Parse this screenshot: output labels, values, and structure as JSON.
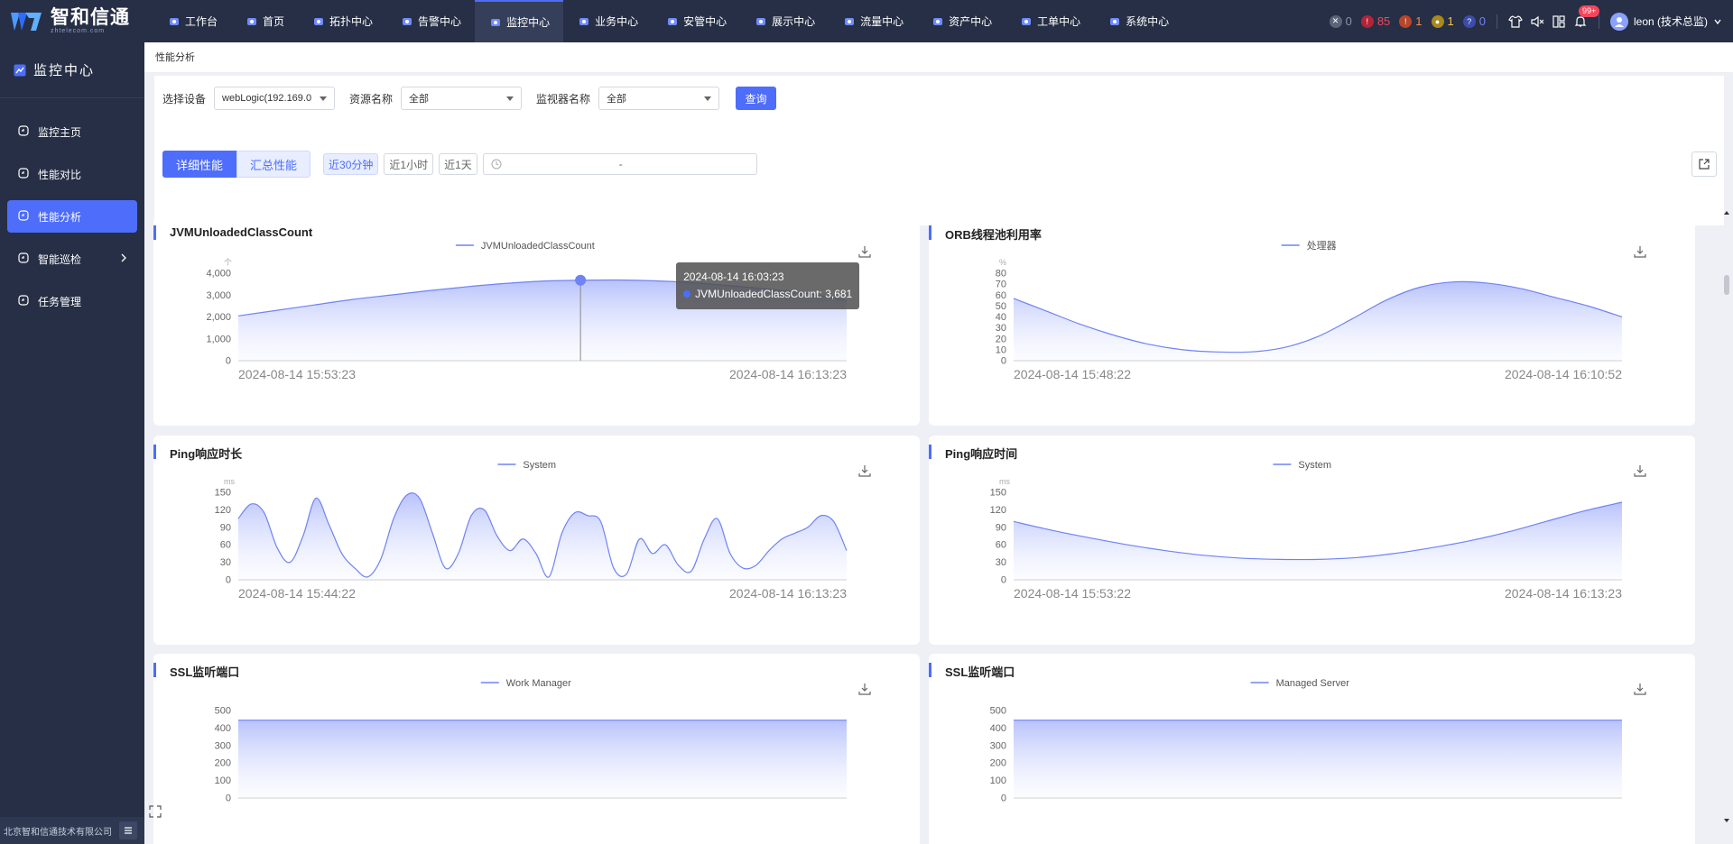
{
  "brand": {
    "name": "智和信通",
    "sub": "zhtelecom.com"
  },
  "nav": [
    {
      "label": "工作台",
      "icon": "workbench-icon",
      "active": false
    },
    {
      "label": "首页",
      "icon": "home-icon",
      "active": false
    },
    {
      "label": "拓扑中心",
      "icon": "topology-icon",
      "active": false
    },
    {
      "label": "告警中心",
      "icon": "alarm-icon",
      "active": false
    },
    {
      "label": "监控中心",
      "icon": "monitor-icon",
      "active": true
    },
    {
      "label": "业务中心",
      "icon": "business-icon",
      "active": false
    },
    {
      "label": "安管中心",
      "icon": "security-icon",
      "active": false
    },
    {
      "label": "展示中心",
      "icon": "display-icon",
      "active": false
    },
    {
      "label": "流量中心",
      "icon": "traffic-icon",
      "active": false
    },
    {
      "label": "资产中心",
      "icon": "asset-icon",
      "active": false
    },
    {
      "label": "工单中心",
      "icon": "ticket-icon",
      "active": false
    },
    {
      "label": "系统中心",
      "icon": "system-icon",
      "active": false
    }
  ],
  "stats": [
    {
      "value": "0",
      "color": "#5c6478",
      "text_color": "#8a93a8"
    },
    {
      "value": "85",
      "color": "#b3243a",
      "text_color": "#f5455b"
    },
    {
      "value": "1",
      "color": "#b8462a",
      "text_color": "#f58a45"
    },
    {
      "value": "1",
      "color": "#a8891c",
      "text_color": "#f5c445"
    },
    {
      "value": "0",
      "color": "#3c4ca8",
      "text_color": "#6f83f5"
    }
  ],
  "notify_badge": "99+",
  "user": {
    "name": "leon (技术总监)"
  },
  "sidebar": {
    "title": "监控中心",
    "items": [
      {
        "label": "监控主页",
        "icon": "home-icon",
        "active": false
      },
      {
        "label": "性能对比",
        "icon": "compare-icon",
        "active": false
      },
      {
        "label": "性能分析",
        "icon": "analysis-icon",
        "active": true
      },
      {
        "label": "智能巡检",
        "icon": "inspection-icon",
        "active": false,
        "has_children": true
      },
      {
        "label": "任务管理",
        "icon": "task-icon",
        "active": false
      }
    ],
    "footer": "北京智和信通技术有限公司"
  },
  "breadcrumb": "性能分析",
  "filter": {
    "device_label": "选择设备",
    "device_value": "webLogic(192.169.0",
    "resource_label": "资源名称",
    "resource_value": "全部",
    "monitor_label": "监视器名称",
    "monitor_value": "全部",
    "query_label": "查询",
    "tab_detail": "详细性能",
    "tab_summary": "汇总性能",
    "range_30m": "近30分钟",
    "range_1h": "近1小时",
    "range_1d": "近1天",
    "range_dash": "-"
  },
  "charts": [
    {
      "title": "JVMUnloadedClassCount",
      "legend": "JVMUnloadedClassCount",
      "unit": "个",
      "yticks": [
        "4,000",
        "3,000",
        "2,000",
        "1,000",
        "0"
      ],
      "ymax": 4000,
      "values": [
        2050,
        2300,
        2550,
        2800,
        3000,
        3200,
        3380,
        3530,
        3640,
        3681,
        3690,
        3650,
        3560,
        3420,
        3260,
        3060,
        2750
      ],
      "x_start": "2024-08-14 15:53:23",
      "x_end": "2024-08-14 16:13:23",
      "tooltip": {
        "time": "2024-08-14 16:03:23",
        "series": "JVMUnloadedClassCount",
        "value": "3,681",
        "index": 9
      }
    },
    {
      "title": "ORB线程池利用率",
      "legend": "处理器",
      "unit": "%",
      "yticks": [
        "80",
        "70",
        "60",
        "50",
        "40",
        "30",
        "20",
        "10",
        "0"
      ],
      "ymax": 80,
      "values": [
        57,
        45,
        33,
        23,
        15,
        10,
        8,
        8,
        12,
        22,
        38,
        55,
        67,
        72,
        71,
        66,
        58,
        50,
        40
      ],
      "x_start": "2024-08-14 15:48:22",
      "x_end": "2024-08-14 16:10:52"
    },
    {
      "title": "Ping响应时长",
      "legend": "System",
      "unit": "ms",
      "yticks": [
        "150",
        "120",
        "90",
        "60",
        "30",
        "0"
      ],
      "ymax": 150,
      "values": [
        105,
        130,
        115,
        55,
        30,
        75,
        140,
        95,
        45,
        20,
        5,
        35,
        105,
        145,
        140,
        80,
        20,
        45,
        110,
        120,
        75,
        50,
        70,
        45,
        5,
        80,
        115,
        110,
        100,
        20,
        10,
        70,
        45,
        60,
        25,
        15,
        70,
        105,
        45,
        20,
        25,
        50,
        70,
        80,
        90,
        110,
        100,
        50
      ],
      "x_start": "2024-08-14 15:44:22",
      "x_end": "2024-08-14 16:13:23"
    },
    {
      "title": "Ping响应时间",
      "legend": "System",
      "unit": "ms",
      "yticks": [
        "150",
        "120",
        "90",
        "60",
        "30",
        "0"
      ],
      "ymax": 150,
      "values": [
        100,
        85,
        72,
        60,
        50,
        42,
        37,
        35,
        35,
        38,
        45,
        55,
        67,
        82,
        100,
        118,
        133
      ],
      "x_start": "2024-08-14 15:53:22",
      "x_end": "2024-08-14 16:13:23"
    },
    {
      "title": "SSL监听端口",
      "legend": "Work Manager",
      "unit": "",
      "yticks": [
        "500",
        "400",
        "300",
        "200",
        "100",
        "0"
      ],
      "ymax": 500,
      "values": [
        445,
        445,
        445,
        445,
        445,
        445,
        445,
        445,
        445,
        445
      ],
      "x_start": "",
      "x_end": ""
    },
    {
      "title": "SSL监听端口",
      "legend": "Managed Server",
      "unit": "",
      "yticks": [
        "500",
        "400",
        "300",
        "200",
        "100",
        "0"
      ],
      "ymax": 500,
      "values": [
        445,
        445,
        445,
        445,
        445,
        445,
        445,
        445,
        445,
        445
      ],
      "x_start": "",
      "x_end": ""
    }
  ],
  "watermark": "北京智和信通技术有限公司",
  "colors": {
    "accent": "#4d6dfa",
    "nav_bg": "#262f45",
    "line": "#6f83f5"
  }
}
